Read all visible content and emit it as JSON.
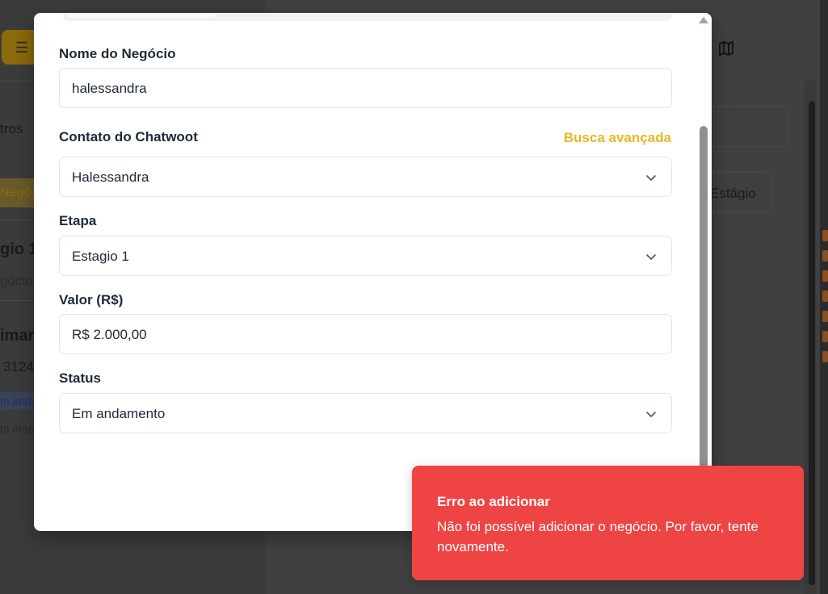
{
  "background": {
    "filters_label": "tros",
    "deal_tag": "Negóc",
    "stage_title": "gio 1",
    "stage_sub": "gócio",
    "contact_name": "imar",
    "contact_phone": "3124",
    "status_tag": "m anda",
    "next_stage": "ta etap",
    "stage_button": "Estágio",
    "map_icon": "map-icon"
  },
  "modal": {
    "business_name": {
      "label": "Nome do Negócio",
      "value": "halessandra"
    },
    "contact": {
      "label": "Contato do Chatwoot",
      "advanced_search": "Busca avançada",
      "value": "Halessandra"
    },
    "stage": {
      "label": "Etapa",
      "value": "Estagio 1"
    },
    "amount": {
      "label": "Valor (R$)",
      "value": "R$ 2.000,00"
    },
    "status": {
      "label": "Status",
      "value": "Em andamento"
    }
  },
  "toast": {
    "title": "Erro ao adicionar",
    "message": "Não foi possível adicionar o negócio. Por favor, tente novamente.",
    "color": "#ef4444"
  },
  "colors": {
    "accent": "#e6b824",
    "error": "#ef4444"
  }
}
